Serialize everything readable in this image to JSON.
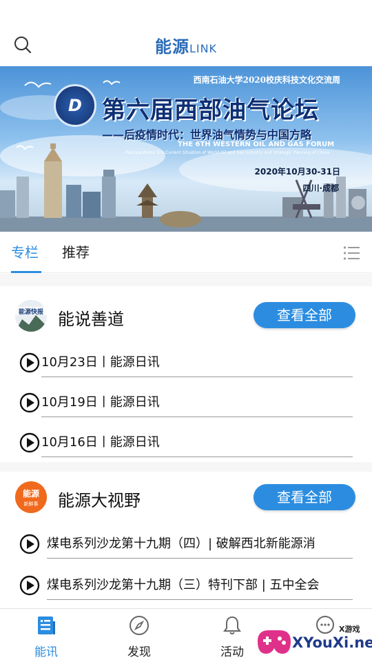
{
  "header": {
    "logo_cn": "能源",
    "logo_en": "LINK"
  },
  "banner": {
    "organizer": "西南石油大学2020校庆科技文化交流周",
    "title": "第六届西部油气论坛",
    "theme": "——后疫情时代：世界油气情势与中国方略",
    "english_title": "THE 6TH WESTERN OIL AND GAS FORUM",
    "english_subtitle": "Post-pandemic Era:Current Situation of World Oil and Gas Industry and Strategic Planning of China",
    "date": "2020年10月30-31日",
    "place": "四川·成都"
  },
  "tabs": [
    {
      "label": "专栏",
      "active": true
    },
    {
      "label": "推荐",
      "active": false
    }
  ],
  "sections": [
    {
      "title": "能说善道",
      "view_all": "查看全部",
      "icon_text": "能源快报",
      "items": [
        {
          "label": "10月23日丨能源日讯"
        },
        {
          "label": "10月19日丨能源日讯"
        },
        {
          "label": "10月16日丨能源日讯"
        }
      ]
    },
    {
      "title": "能源大视野",
      "view_all": "查看全部",
      "icon_text": "能源",
      "icon_subtext": "新鲜事",
      "items": [
        {
          "label": "煤电系列沙龙第十九期（四）| 破解西北新能源消"
        },
        {
          "label": "煤电系列沙龙第十九期（三）特刊下部 | 五中全会"
        }
      ]
    }
  ],
  "bottom_nav": [
    {
      "label": "能讯",
      "icon": "news-icon",
      "active": true
    },
    {
      "label": "发现",
      "icon": "compass-icon",
      "active": false
    },
    {
      "label": "活动",
      "icon": "bell-icon",
      "active": false
    },
    {
      "label": "",
      "icon": "chat-icon",
      "active": false
    }
  ],
  "watermark": {
    "text_en": "XYouXi.net",
    "text_cn": "X游戏"
  },
  "colors": {
    "accent": "#2c8de0",
    "logo": "#2b6cb8",
    "banner_title": "#0d2f74"
  }
}
